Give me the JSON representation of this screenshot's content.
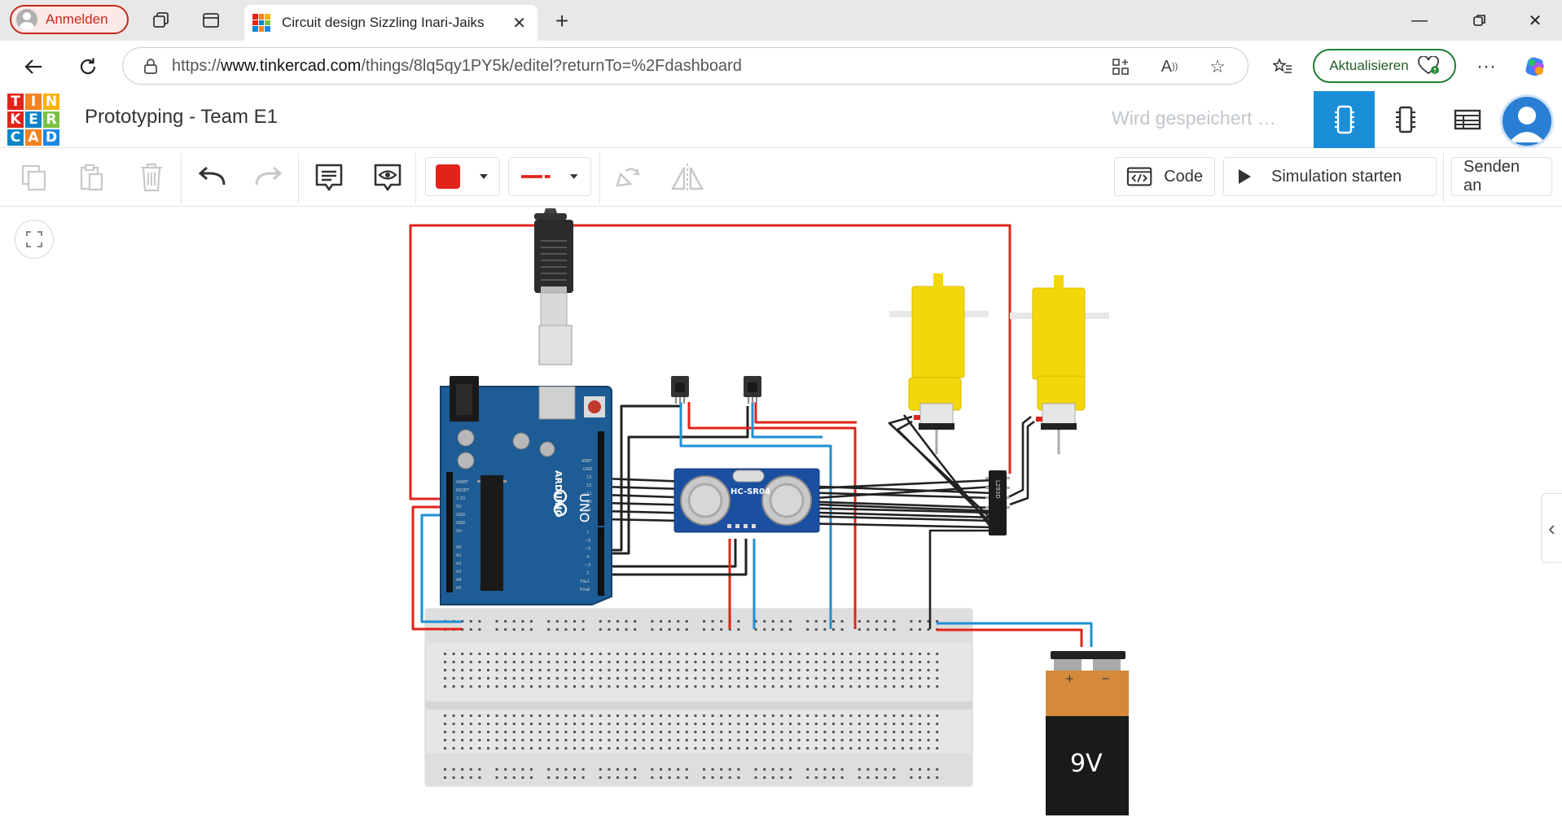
{
  "browser": {
    "profile_label": "Anmelden",
    "tab_title": "Circuit design Sizzling Inari-Jaiks",
    "url_host": "www.tinkercad.com",
    "url_scheme": "https://",
    "url_path": "/things/8lq5qy1PY5k/editel?returnTo=%2Fdashboard",
    "update_label": "Aktualisieren"
  },
  "app": {
    "logo_letters": [
      "T",
      "I",
      "N",
      "K",
      "E",
      "R",
      "C",
      "A",
      "D"
    ],
    "logo_colors": [
      "#e2231a",
      "#f58220",
      "#f9b200",
      "#e2231a",
      "#0b85c8",
      "#7cc242",
      "#0b85c8",
      "#f58220",
      "#1e88e5"
    ],
    "design_title": "Prototyping - Team E1",
    "save_status": "Wird gespeichert …",
    "accent": "#1b8ed8"
  },
  "toolbar": {
    "code_label": "Code",
    "simulate_label": "Simulation starten",
    "send_label": "Senden an",
    "fill_color": "#e2231a",
    "wire_color": "#e2231a"
  },
  "circuit": {
    "arduino_brand": "ARDUINO",
    "arduino_model": "UNO",
    "sensor_label": "HC-SR04",
    "driver_label": "L293D",
    "battery_label": "9V",
    "battery_plus": "+",
    "battery_minus": "−"
  }
}
